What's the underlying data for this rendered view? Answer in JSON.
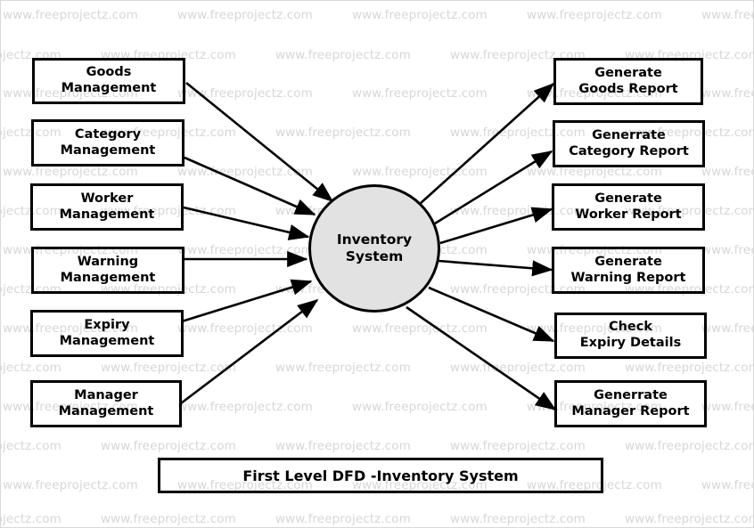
{
  "diagram": {
    "title": "First Level DFD -Inventory System",
    "watermark_text": "www.freeprojectz.com",
    "process": {
      "name": "inventory-system-process",
      "line1": "Inventory",
      "line2": "System",
      "fill_color": "#e2e2e2",
      "stroke_color": "#000000"
    },
    "inputs": [
      {
        "id": "goods-management",
        "line1": "Goods",
        "line2": "Management"
      },
      {
        "id": "category-management",
        "line1": "Category",
        "line2": "Management"
      },
      {
        "id": "worker-management",
        "line1": "Worker",
        "line2": "Management"
      },
      {
        "id": "warning-management",
        "line1": "Warning",
        "line2": "Management"
      },
      {
        "id": "expiry-management",
        "line1": "Expiry",
        "line2": "Management"
      },
      {
        "id": "manager-management",
        "line1": "Manager",
        "line2": "Management"
      }
    ],
    "outputs": [
      {
        "id": "generate-goods-report",
        "line1": "Generate",
        "line2": "Goods Report"
      },
      {
        "id": "generate-category-report",
        "line1": "Generrate",
        "line2": "Category Report"
      },
      {
        "id": "generate-worker-report",
        "line1": "Generate",
        "line2": "Worker Report"
      },
      {
        "id": "generate-warning-report",
        "line1": "Generate",
        "line2": "Warning Report"
      },
      {
        "id": "check-expiry-details",
        "line1": "Check",
        "line2": "Expiry Details"
      },
      {
        "id": "generate-manager-report",
        "line1": "Generrate",
        "line2": "Manager Report"
      }
    ]
  }
}
